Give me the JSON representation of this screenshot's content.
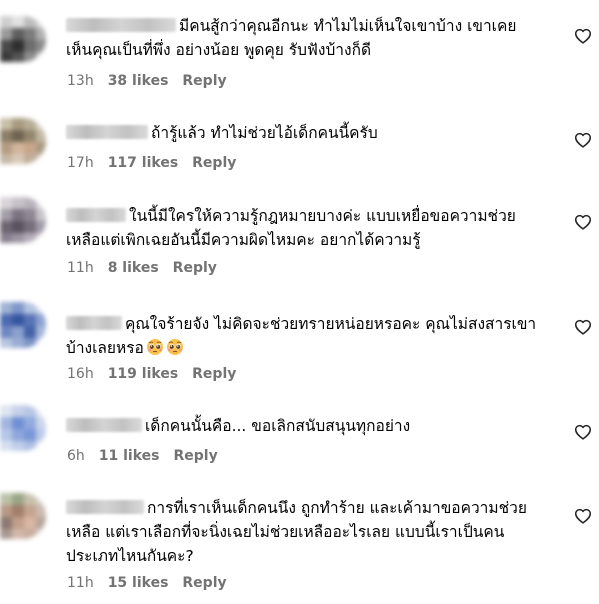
{
  "comments": [
    {
      "lines": [
        "มีคนสู้กว่าคุณอีกนะ ทำไมไม่เห็นใจเขาบ้าง เขาเคย",
        "เห็นคุณเป็นที่พึ่ง อย่างน้อย พูดคุย รับฟังบ้างก็ดี"
      ],
      "time": "13h",
      "likes": "38 likes",
      "reply": "Reply"
    },
    {
      "lines": [
        "ถ้ารู้แล้ว ทำไม่ช่วยไอ้เด็กคนนี้ครับ"
      ],
      "time": "17h",
      "likes": "117 likes",
      "reply": "Reply"
    },
    {
      "lines": [
        "ในนี้มีใครให้ความรู้กฎหมายบางค่ะ แบบเหยื่อขอความช่วย",
        "เหลือแต่เพิกเฉยอันนี้มีความผิดไหมคะ อยากได้ความรู้"
      ],
      "time": "11h",
      "likes": "8 likes",
      "reply": "Reply"
    },
    {
      "lines": [
        "คุณใจร้ายจัง ไม่คิดจะช่วยทรายหน่อยหรอคะ คุณไม่สงสารเขา",
        "บ้างเลยหรอ"
      ],
      "time": "16h",
      "likes": "119 likes",
      "reply": "Reply",
      "emojis": [
        "pleading-face",
        "pleading-face"
      ]
    },
    {
      "lines": [
        "เด็กคนนั้นคือ... ขอเลิกสนับสนุนทุกอย่าง"
      ],
      "time": "6h",
      "likes": "11 likes",
      "reply": "Reply"
    },
    {
      "lines": [
        "การที่เราเห็นเด็กคนนึง ถูกทำร้าย และเค้ามาขอความช่วย",
        "เหลือ แต่เราเลือกที่จะนิ่งเฉยไม่ช่วยเหลืออะไรเลย แบบนี้เราเป็นคน",
        "ประเภทไหนกันคะ?"
      ],
      "time": "11h",
      "likes": "15 likes",
      "reply": "Reply"
    }
  ],
  "icons": {
    "like": "heart-outline-icon",
    "emoji": "pleading-face-emoji"
  },
  "colors": {
    "text": "#000000",
    "meta": "#737373",
    "background": "#ffffff"
  }
}
